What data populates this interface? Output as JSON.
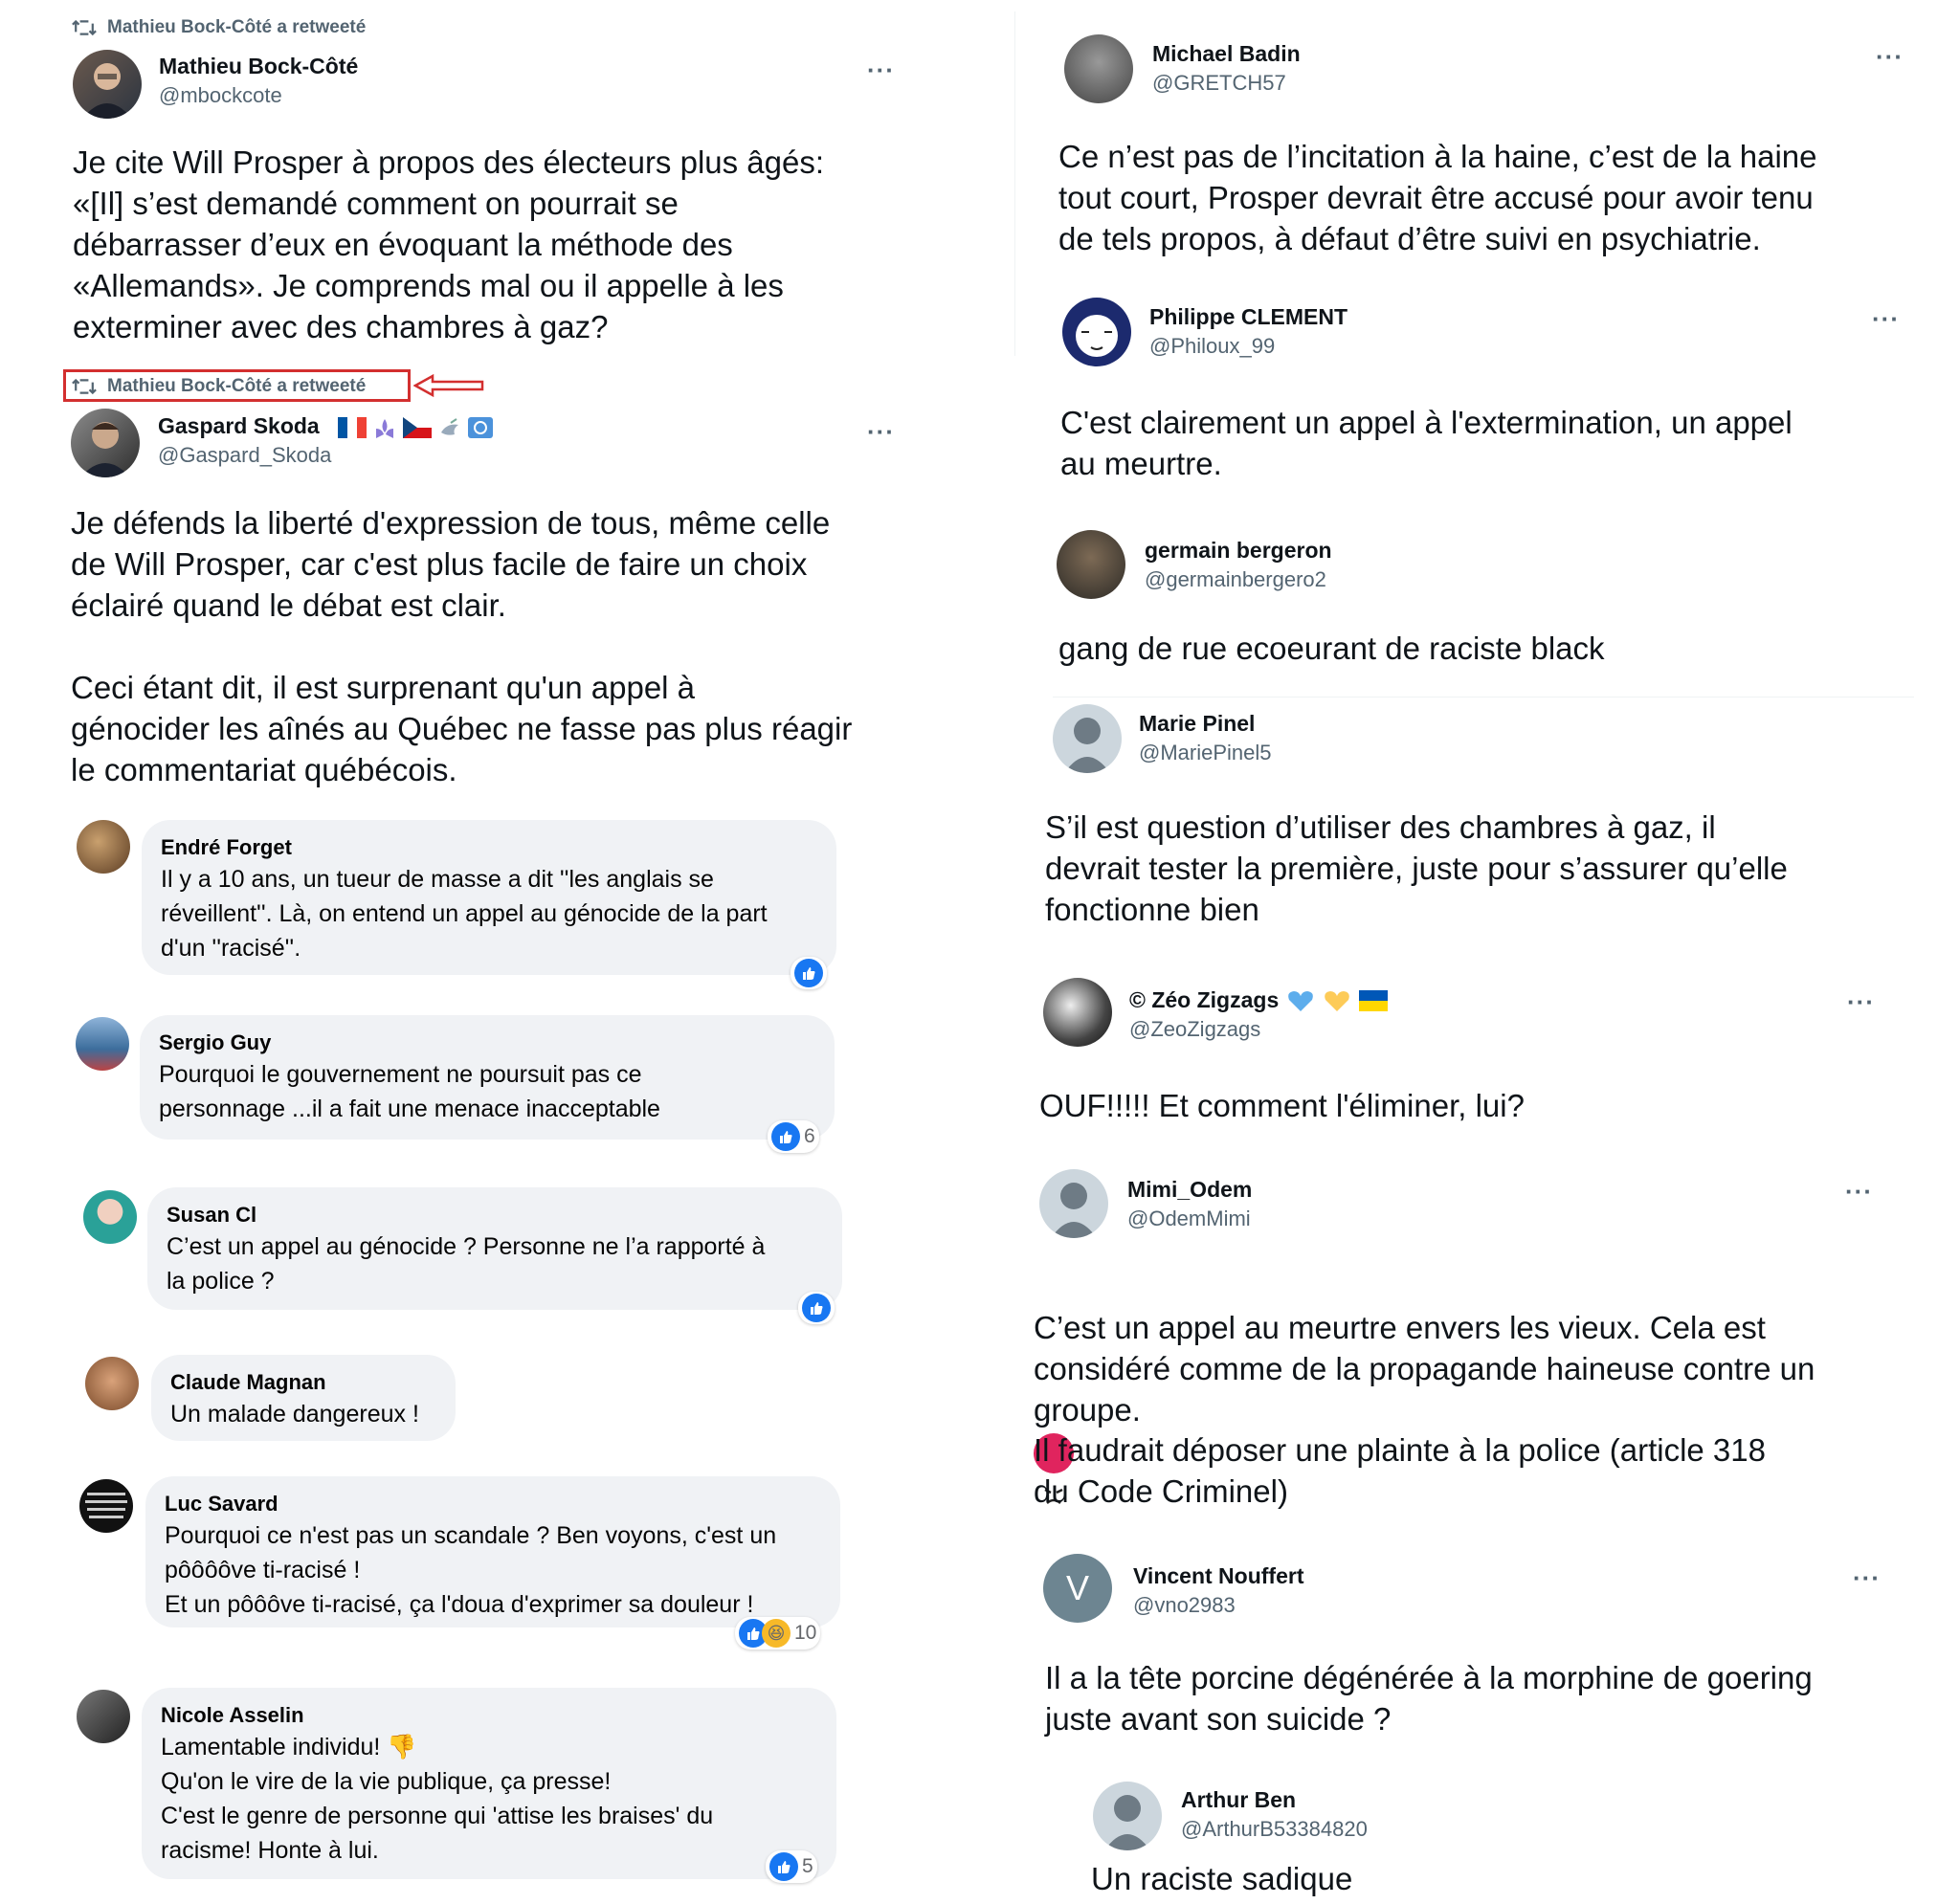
{
  "left": {
    "tweet1": {
      "retweet_label": "Mathieu Bock-Côté a retweeté",
      "name": "Mathieu Bock-Côté",
      "handle": "@mbockcote",
      "more": "···",
      "text": "Je cite Will Prosper à propos des électeurs plus âgés:\n«[Il] s’est demandé comment on pourrait se\ndébarrasser d’eux en évoquant la méthode des\n«Allemands». Je comprends mal ou il appelle à les\nexterminer avec des chambres à gaz?"
    },
    "tweet2": {
      "retweet_label": "Mathieu Bock-Côté a retweeté",
      "name": "Gaspard Skoda",
      "handle": "@Gaspard_Skoda",
      "more": "···",
      "text_p1": "Je défends la liberté d'expression de tous, même celle\nde Will Prosper, car c'est plus facile de faire un choix\néclairé quand le débat est clair.",
      "text_p2": "Ceci étant dit, il est surprenant qu'un appel à\ngénocider les aînés au Québec ne fasse pas plus réagir\nle commentariat québécois."
    },
    "comments": [
      {
        "name": "Endré Forget",
        "text": "Il y a 10 ans, un tueur de masse a dit ''les anglais se\nréveillent''. Là, on entend un appel au génocide de la part\nd'un ''racisé''.",
        "count": ""
      },
      {
        "name": "Sergio Guy",
        "text": "Pourquoi le gouvernement ne poursuit pas ce\npersonnage ...il a fait une menace inacceptable",
        "count": "6"
      },
      {
        "name": "Susan Cl",
        "text": "C’est un appel au génocide ? Personne ne l’a rapporté à\nla police ?",
        "count": ""
      },
      {
        "name": "Claude Magnan",
        "text": "Un malade dangereux !",
        "count": ""
      },
      {
        "name": "Luc Savard",
        "text": "Pourquoi ce n'est pas un scandale ? Ben voyons, c'est un\npôôôôve ti-racisé !\nEt un pôôôve ti-racisé, ça l'doua d'exprimer sa douleur !",
        "count": "10"
      },
      {
        "name": "Nicole Asselin",
        "text": "Lamentable individu! 👎\nQu'on le vire de la vie publique, ça presse!\nC'est le genre de personne qui 'attise les braises' du\nracisme! Honte à lui.",
        "count": "5"
      }
    ]
  },
  "right": {
    "replies": [
      {
        "name": "Michael Badin",
        "handle": "@GRETCH57",
        "text": "Ce n’est pas de l’incitation à la haine, c’est de la haine\ntout court, Prosper devrait être accusé pour avoir tenu\nde tels propos, à défaut d’être suivi en psychiatrie."
      },
      {
        "name": "Philippe CLEMENT",
        "handle": "@Philoux_99",
        "text": "C'est clairement un appel à l'extermination, un appel\nau meurtre."
      },
      {
        "name": "germain bergeron",
        "handle": "@germainbergero2",
        "text": "gang de rue ecoeurant de raciste black"
      },
      {
        "name": "Marie Pinel",
        "handle": "@MariePinel5",
        "text": "S’il est question d’utiliser des chambres à gaz,  il\ndevrait tester la première,  juste pour s’assurer qu’elle\nfonctionne bien"
      },
      {
        "name": "© Zéo Zigzags",
        "handle": "@ZeoZigzags",
        "text": "OUF!!!!! Et comment l'éliminer, lui?"
      },
      {
        "name": "Mimi_Odem",
        "handle": "@OdemMimi",
        "text_p1": "C’est un appel au meurtre envers les vieux. Cela est\nconsidéré comme de la propagande haineuse contre un\ngroupe.",
        "text_p2": "Il faudrait déposer une plainte à la police  (article 318\ndu Code Criminel)"
      },
      {
        "name": "Vincent Nouffert",
        "handle": "@vno2983",
        "avatar_letter": "V",
        "text": "Il a la tête porcine dégénérée à la morphine de goering\njuste avant son suicide ?"
      },
      {
        "name": "Arthur Ben",
        "handle": "@ArthurB53384820",
        "text": "Un raciste sadique"
      }
    ],
    "more": "···"
  },
  "colors": {
    "twitter_text": "#0f1419",
    "twitter_secondary": "#536471",
    "fb_bubble": "#f0f2f5",
    "fb_like": "#1877f2",
    "highlight": "#d32f2f"
  }
}
